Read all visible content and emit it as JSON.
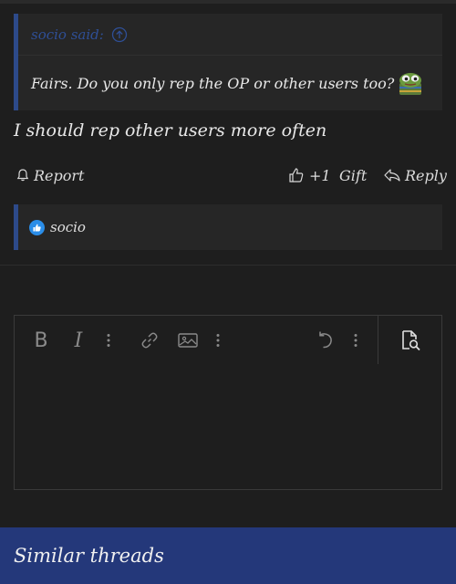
{
  "quote": {
    "author_said": "socio said:",
    "text": "Fairs. Do you only rep the OP or other users too?",
    "emoji": "pepe-emoji"
  },
  "post": {
    "text": "I should rep other users more often"
  },
  "actions": {
    "report": "Report",
    "like": "+1",
    "gift": "Gift",
    "reply": "Reply"
  },
  "reactions": {
    "users": "socio"
  },
  "editor": {
    "bold": "B",
    "italic": "I",
    "icons": [
      "bold-icon",
      "italic-icon",
      "more-options-icon",
      "link-icon",
      "image-icon",
      "undo-icon",
      "preview-icon"
    ]
  },
  "footer": {
    "similar_threads": "Similar threads"
  },
  "colors": {
    "background": "#1e1e1e",
    "panel": "#262626",
    "accent_border": "#2d4a8a",
    "quote_author": "#2f4f96",
    "like_badge": "#2a8de8",
    "footer_bar": "#24387a"
  }
}
